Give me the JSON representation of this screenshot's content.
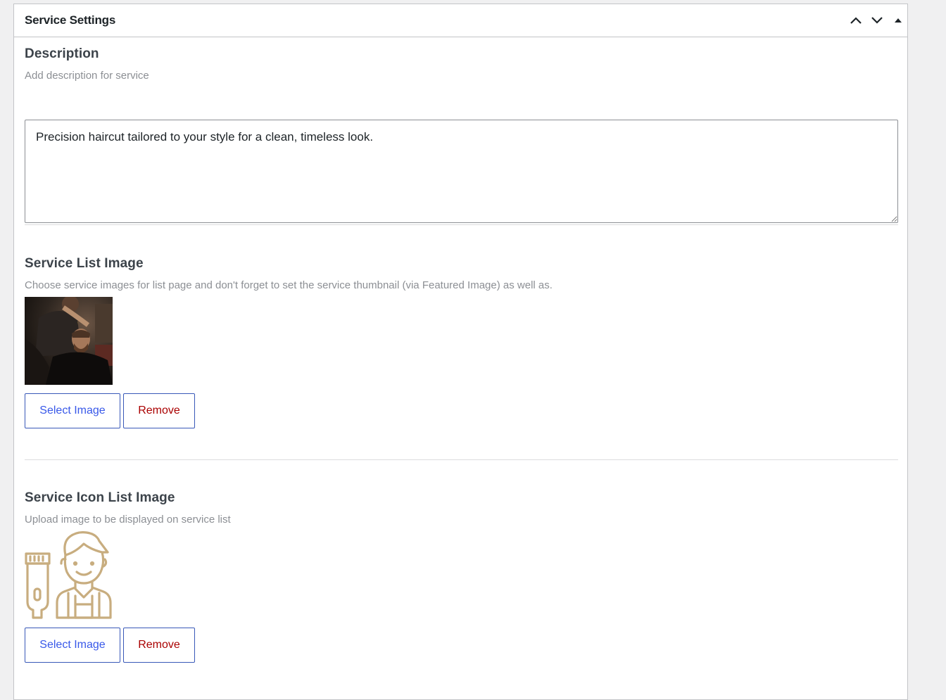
{
  "metabox": {
    "title": "Service Settings",
    "controls": [
      "chevron-up-icon",
      "chevron-down-icon",
      "triangle-up-icon"
    ]
  },
  "description": {
    "title": "Description",
    "help": "Add description for service",
    "value": "Precision haircut tailored to your style for a clean, timeless look."
  },
  "service_list_image": {
    "title": "Service List Image",
    "help": "Choose service images for list page and don't forget to set the service thumbnail (via Featured Image) as well as.",
    "select_label": "Select Image",
    "remove_label": "Remove"
  },
  "service_icon_image": {
    "title": "Service Icon List Image",
    "help": "Upload image to be displayed on service list",
    "select_label": "Select Image",
    "remove_label": "Remove",
    "icon_color": "#c8ad7f"
  },
  "colors": {
    "link": "#3858e9",
    "danger": "#aa0000",
    "border": "#c3c4c7"
  }
}
